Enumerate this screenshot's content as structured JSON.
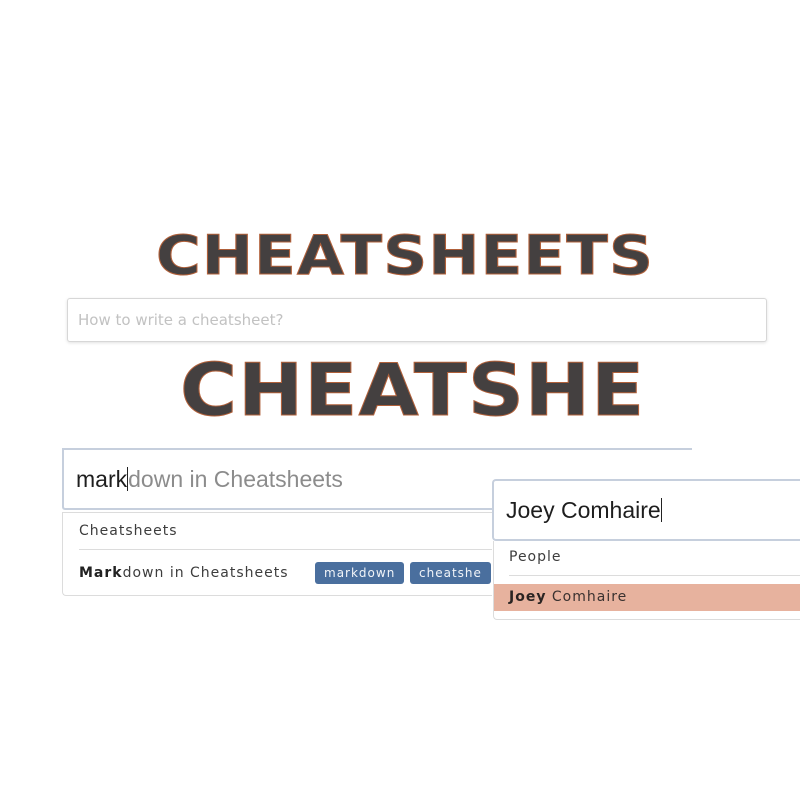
{
  "logo_top": {
    "text": "CHEATSHEETS"
  },
  "search_top": {
    "placeholder": "How to write a cheatsheet?"
  },
  "logo_mid": {
    "text": "CHEATSHE"
  },
  "search_mid": {
    "typed": "mark",
    "suggestion": "down in Cheatsheets"
  },
  "dropdown_mid": {
    "header": "Cheatsheets",
    "item": {
      "title_bold": "Mark",
      "title_rest": "down in Cheatsheets",
      "tags": [
        "markdown",
        "cheatshe"
      ]
    }
  },
  "search_right": {
    "value": "Joey Comhaire"
  },
  "dropdown_right": {
    "header": "People",
    "item": {
      "title_bold": "Joey",
      "title_rest": " Comhaire"
    }
  },
  "colors": {
    "logo_fill": "#444040",
    "logo_outline": "#b0603a",
    "tag_bg": "#4a6f9e",
    "highlight_bg": "#e7b29e",
    "focus_border": "#c6cfdd"
  }
}
